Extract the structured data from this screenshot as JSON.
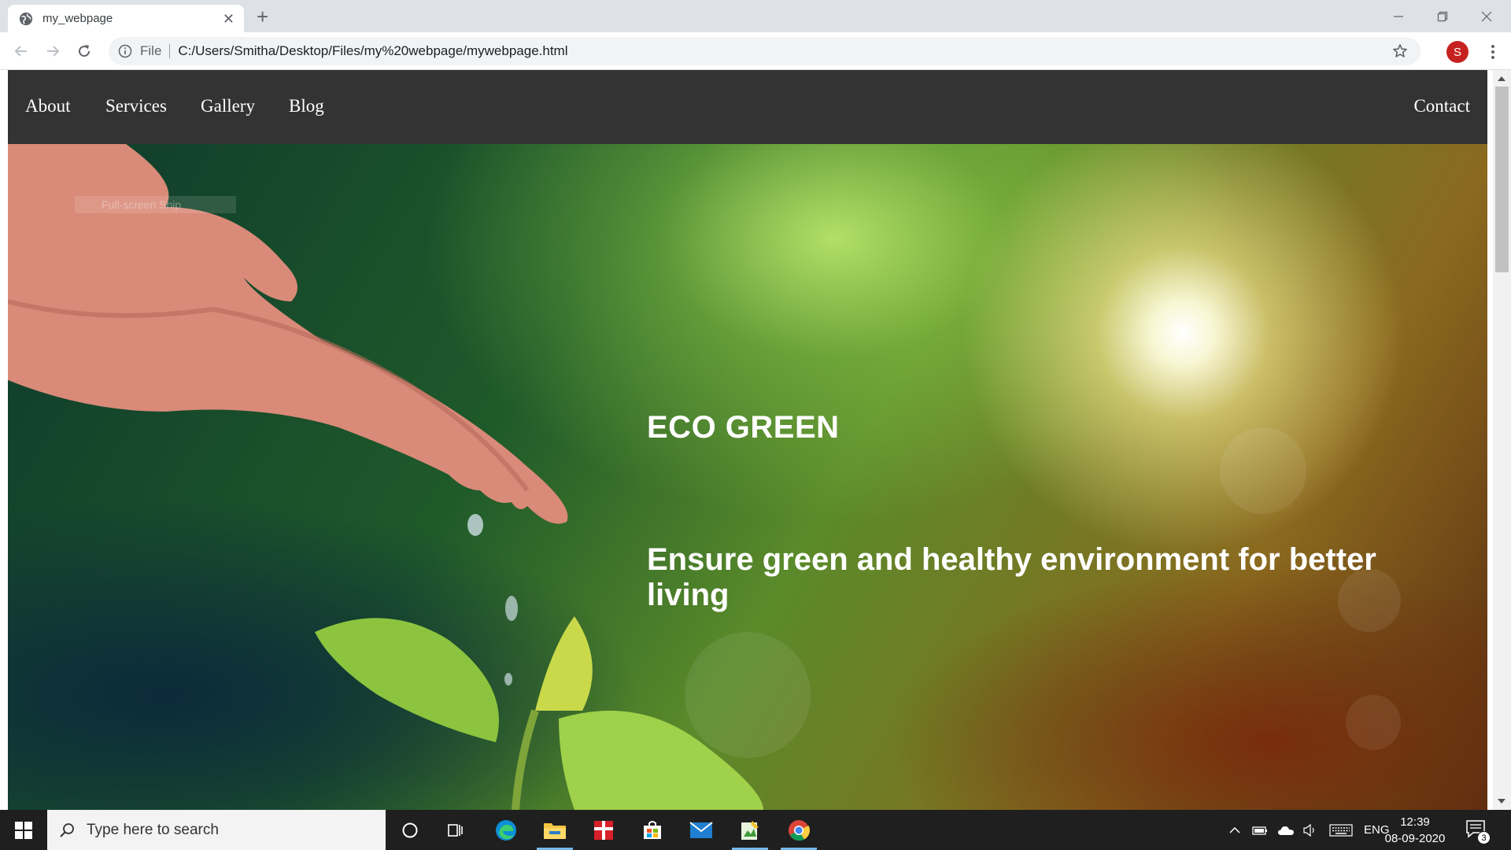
{
  "browser": {
    "tab_title": "my_webpage",
    "url_scheme_label": "File",
    "url": "C:/Users/Smitha/Desktop/Files/my%20webpage/mywebpage.html",
    "profile_initial": "S"
  },
  "page": {
    "nav": {
      "links": [
        "About",
        "Services",
        "Gallery",
        "Blog"
      ],
      "contact": "Contact"
    },
    "hero": {
      "title": "ECO GREEN",
      "subtitle": "Ensure green and healthy environment for better living",
      "snip_overlay": "Full-screen Snip"
    },
    "colors": {
      "nav_bg": "#333333",
      "nav_text": "#ffffff",
      "hero_text": "#ffffff"
    }
  },
  "taskbar": {
    "search_placeholder": "Type here to search",
    "language": "ENG",
    "time": "12:39",
    "date": "08-09-2020",
    "notification_count": "3",
    "pinned_apps": [
      "cortana-icon",
      "task-view-icon",
      "edge-icon",
      "file-explorer-icon",
      "gift-app-icon",
      "store-icon",
      "mail-icon",
      "notepad-icon",
      "chrome-icon"
    ]
  }
}
